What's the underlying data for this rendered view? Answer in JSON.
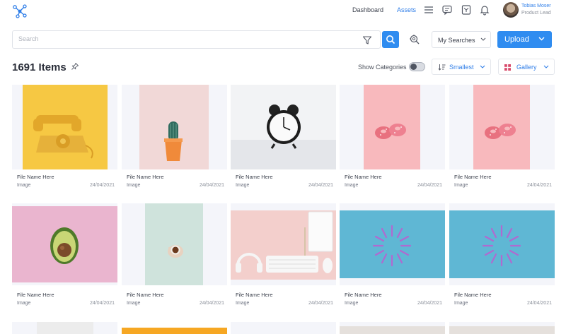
{
  "nav": {
    "dashboard": "Dashboard",
    "assets": "Assets",
    "accent": "#2f7ee8",
    "icons": [
      "hamburger-icon",
      "chat-icon",
      "inbox-icon",
      "bell-icon"
    ]
  },
  "user": {
    "name": "Tobias Moser",
    "role": "Product Lead"
  },
  "search": {
    "placeholder": "Search",
    "value": "",
    "my_searches": "My Searches",
    "upload": "Upload"
  },
  "toolbar": {
    "title": "1691 Items",
    "show_categories": "Show Categories",
    "show_categories_on": false,
    "sort": "Smallest",
    "view": "Gallery"
  },
  "items": [
    {
      "name": "File Name Here",
      "type": "Image",
      "date": "24/04/2021",
      "subject": "yellow-telephone"
    },
    {
      "name": "File Name Here",
      "type": "Image",
      "date": "24/04/2021",
      "subject": "cactus"
    },
    {
      "name": "File Name Here",
      "type": "Image",
      "date": "24/04/2021",
      "subject": "alarm-clock"
    },
    {
      "name": "File Name Here",
      "type": "Image",
      "date": "24/04/2021",
      "subject": "donuts"
    },
    {
      "name": "File Name Here",
      "type": "Image",
      "date": "24/04/2021",
      "subject": "donuts"
    },
    {
      "name": "File Name Here",
      "type": "Image",
      "date": "24/04/2021",
      "subject": "avocado"
    },
    {
      "name": "File Name Here",
      "type": "Image",
      "date": "24/04/2021",
      "subject": "coffee-cup"
    },
    {
      "name": "File Name Here",
      "type": "Image",
      "date": "24/04/2021",
      "subject": "desk-setup"
    },
    {
      "name": "File Name Here",
      "type": "Image",
      "date": "24/04/2021",
      "subject": "paperclips"
    },
    {
      "name": "File Name Here",
      "type": "Image",
      "date": "24/04/2021",
      "subject": "paperclips"
    }
  ]
}
